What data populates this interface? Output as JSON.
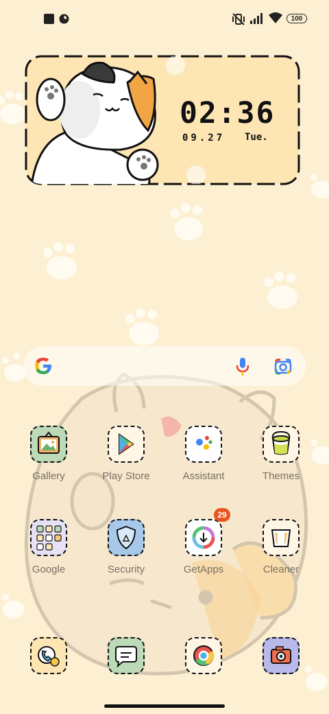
{
  "status_bar": {
    "battery": "100"
  },
  "clock": {
    "time": "02:36",
    "date": "09.27",
    "day": "Tue."
  },
  "apps_row1": [
    {
      "label": "Gallery"
    },
    {
      "label": "Play Store"
    },
    {
      "label": "Assistant"
    },
    {
      "label": "Themes"
    }
  ],
  "apps_row2": [
    {
      "label": "Google"
    },
    {
      "label": "Security"
    },
    {
      "label": "GetApps",
      "badge": "29"
    },
    {
      "label": "Cleaner"
    }
  ],
  "colors": {
    "background": "#fdf0d2",
    "accent_orange": "#f7be57",
    "badge": "#e8541f"
  }
}
